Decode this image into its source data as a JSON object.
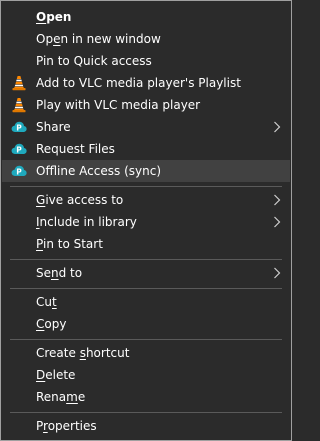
{
  "context_menu": {
    "items": [
      {
        "label_pre": "",
        "label_key": "O",
        "label_post": "pen",
        "icon": ""
      },
      {
        "label_pre": "Op",
        "label_key": "e",
        "label_post": "n in new window",
        "icon": ""
      },
      {
        "label_pre": "Pin to Quick access",
        "label_key": "",
        "label_post": "",
        "icon": ""
      },
      {
        "label_pre": "Add to VLC media player's Playlist",
        "label_key": "",
        "label_post": "",
        "icon": "vlc-icon"
      },
      {
        "label_pre": "Play with VLC media player",
        "label_key": "",
        "label_post": "",
        "icon": "vlc-icon"
      },
      {
        "label_pre": "Share",
        "label_key": "",
        "label_post": "",
        "icon": "pcloud-icon",
        "submenu": true
      },
      {
        "label_pre": "Request Files",
        "label_key": "",
        "label_post": "",
        "icon": "pcloud-icon"
      },
      {
        "label_pre": "Offline Access (sync)",
        "label_key": "",
        "label_post": "",
        "icon": "pcloud-icon",
        "highlighted": true
      },
      {
        "label_pre": "",
        "label_key": "G",
        "label_post": "ive access to",
        "submenu": true
      },
      {
        "label_pre": "",
        "label_key": "I",
        "label_post": "nclude in library",
        "submenu": true
      },
      {
        "label_pre": "",
        "label_key": "P",
        "label_post": "in to Start"
      },
      {
        "label_pre": "Se",
        "label_key": "n",
        "label_post": "d to",
        "submenu": true
      },
      {
        "label_pre": "Cu",
        "label_key": "t",
        "label_post": ""
      },
      {
        "label_pre": "",
        "label_key": "C",
        "label_post": "opy"
      },
      {
        "label_pre": "Create ",
        "label_key": "s",
        "label_post": "hortcut"
      },
      {
        "label_pre": "",
        "label_key": "D",
        "label_post": "elete"
      },
      {
        "label_pre": "Rena",
        "label_key": "m",
        "label_post": "e"
      },
      {
        "label_pre": "P",
        "label_key": "r",
        "label_post": "operties"
      }
    ]
  },
  "colors": {
    "background": "#2b2b2b",
    "highlight": "#414141",
    "text": "#ffffff",
    "vlc_orange": "#f08c00",
    "pcloud_teal": "#20a6b8"
  }
}
